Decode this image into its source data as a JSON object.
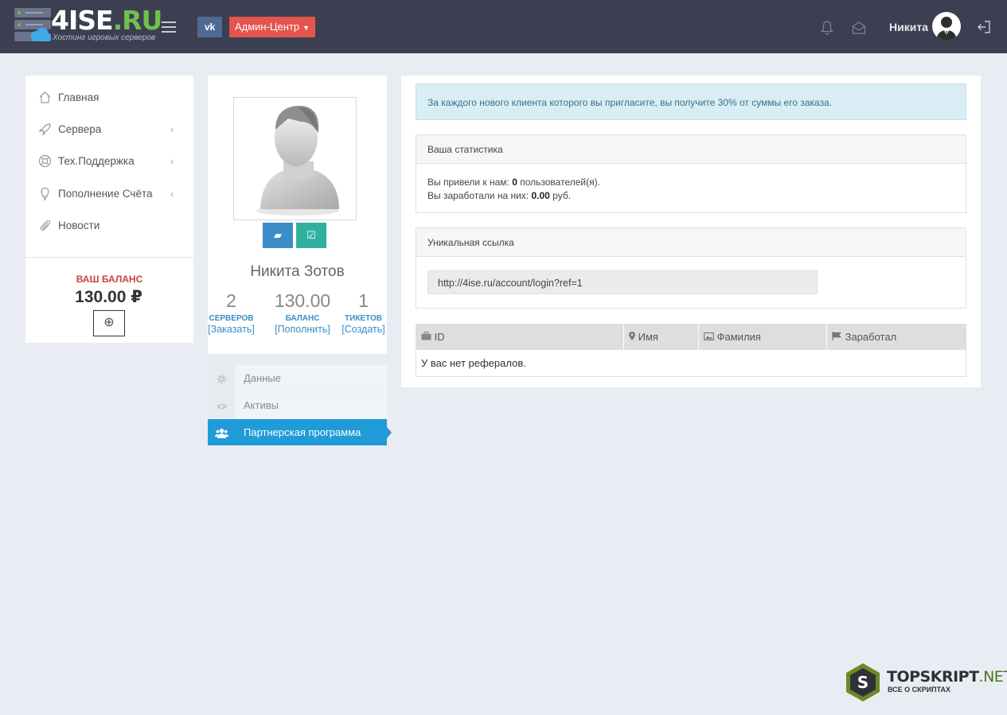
{
  "header": {
    "logo_main": "4ISE",
    "logo_accent": ".RU",
    "logo_sub": "Хостинг игровых серверов",
    "vk_label": "vk",
    "admin_label": "Админ-Центр",
    "user_name": "Никита",
    "icons": [
      "menu-icon",
      "bell-icon",
      "envelope-icon",
      "logout-icon"
    ]
  },
  "sidebar": {
    "items": [
      {
        "label": "Главная",
        "icon": "home-icon"
      },
      {
        "label": "Сервера",
        "icon": "rocket-icon"
      },
      {
        "label": "Тех.Поддержка",
        "icon": "lifebuoy-icon"
      },
      {
        "label": "Пополнение Счёта",
        "icon": "lightbulb-icon"
      },
      {
        "label": "Новости",
        "icon": "paperclip-icon"
      }
    ],
    "balance_title": "ВАШ БАЛАНС",
    "balance_value": "130.00 ₽"
  },
  "profile": {
    "name": "Никита Зотов",
    "stats": [
      {
        "value": "2",
        "caption": "СЕРВЕРОВ",
        "action": "[Заказать]"
      },
      {
        "value": "130.00",
        "caption": "БАЛАНС",
        "action": "[Пополнить]"
      },
      {
        "value": "1",
        "caption": "ТИКЕТОВ",
        "action": "[Создать]"
      }
    ],
    "menu": [
      {
        "label": "Данные",
        "icon": "gear-icon"
      },
      {
        "label": "Активы",
        "icon": "eye-icon"
      },
      {
        "label": "Партнерская программа",
        "icon": "users-icon"
      }
    ]
  },
  "main": {
    "alert": "За каждого нового клиента которого вы пригласите, вы получите 30% от суммы его заказа.",
    "stats_title": "Ваша статистика",
    "line1_prefix": "Вы привели к нам: ",
    "line1_value": "0",
    "line1_suffix": " пользователей(я).",
    "line2_prefix": "Вы заработали на них: ",
    "line2_value": "0.00",
    "line2_suffix": " руб.",
    "link_title": "Уникальная ссылка",
    "ref_link": "http://4ise.ru/account/login?ref=1",
    "table": {
      "columns": [
        "ID",
        "Имя",
        "Фамилия",
        "Заработал"
      ],
      "empty": "У вас нет рефералов."
    }
  },
  "watermark": {
    "main": "TOPSKRIPT",
    "accent": ".NET",
    "sub": "ВСЕ О СКРИПТАХ"
  },
  "colors": {
    "topbar": "#3b3f51",
    "accent_green": "#6ec14a",
    "admin_red": "#e4554e",
    "link_blue": "#3c8dc7",
    "active_blue": "#1f9bd8"
  }
}
